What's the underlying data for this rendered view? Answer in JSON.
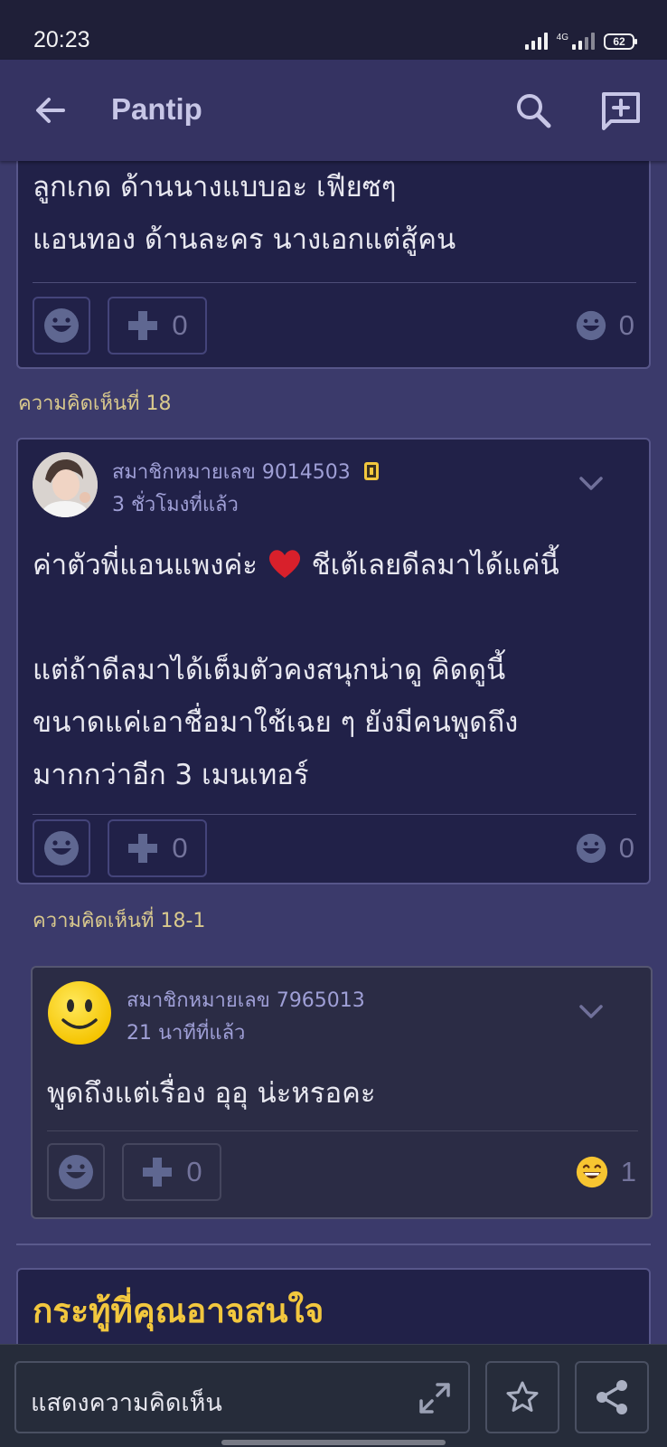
{
  "status_bar": {
    "time": "20:23",
    "network": "4G",
    "battery": "62"
  },
  "app_bar": {
    "title": "Pantip"
  },
  "comment_17": {
    "lines": [
      "ลูกเกด ด้านนางแบบอะ เฟียซๆ",
      "แอนทอง ด้านละคร นางเอกแต่สู้คน"
    ],
    "plus_count": "0",
    "emotion_count": "0"
  },
  "comment_18": {
    "label": "ความคิดเห็นที่ 18",
    "member": "สมาชิกหมายเลข 9014503",
    "time": "3 ชั่วโมงที่แล้ว",
    "line1": "ค่าตัวพี่แอนแพงค่ะ",
    "heart": "❤️",
    "line1_end": "ชีเต้เลยดีลมาได้แค่นี้",
    "lines": [
      "แต่ถ้าดีลมาได้เต็มตัวคงสนุกน่าดู คิดดูนี้",
      "ขนาดแค่เอาชื่อมาใช้เฉย ๆ ยังมีคนพูดถึง",
      "มากกว่าอีก 3 เมนเทอร์"
    ],
    "plus_count": "0",
    "emotion_count": "0"
  },
  "comment_18_1": {
    "label": "ความคิดเห็นที่ 18-1",
    "member": "สมาชิกหมายเลข 7965013",
    "time": "21 นาทีที่แล้ว",
    "text": "พูดถึงแต่เรื่อง อุอุ น่ะหรอคะ",
    "plus_count": "0",
    "emotion_count": "1"
  },
  "recommend": {
    "title": "กระทู้ที่คุณอาจสนใจ"
  },
  "bottom_bar": {
    "placeholder": "แสดงความคิดเห็น"
  },
  "colors": {
    "background": "#3b3a6b",
    "card": "#212148",
    "accent_gold": "#f2c73e",
    "link": "#9f9fd6"
  }
}
